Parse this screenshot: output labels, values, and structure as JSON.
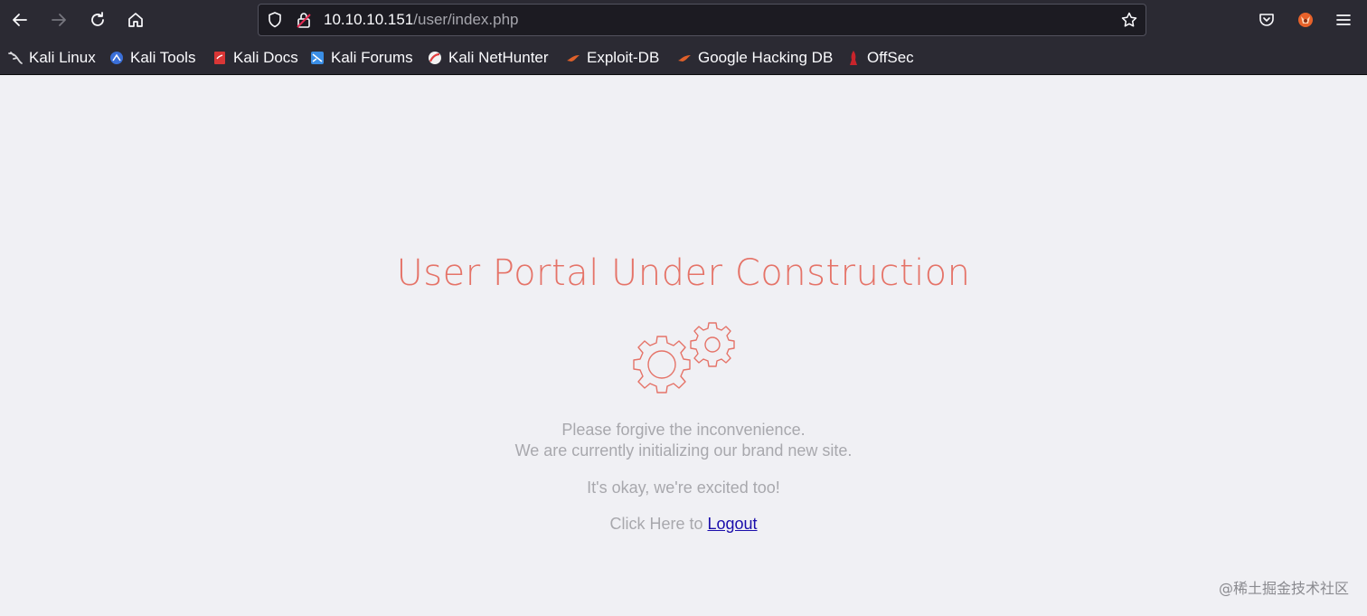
{
  "browser": {
    "url": {
      "host": "10.10.10.151",
      "path": "/user/index.php"
    },
    "bookmarks": [
      {
        "label": "Kali Linux",
        "icon": "kali-dragon-icon",
        "color": "#1c1c1c"
      },
      {
        "label": "Kali Tools",
        "icon": "kali-tools-icon",
        "color": "#3a6fd8"
      },
      {
        "label": "Kali Docs",
        "icon": "kali-docs-icon",
        "color": "#d93636"
      },
      {
        "label": "Kali Forums",
        "icon": "kali-forums-icon",
        "color": "#3a8ee6"
      },
      {
        "label": "Kali NetHunter",
        "icon": "nethunter-icon",
        "color": "#e23d3d"
      },
      {
        "label": "Exploit-DB",
        "icon": "exploit-db-icon",
        "color": "#e0602a"
      },
      {
        "label": "Google Hacking DB",
        "icon": "ghdb-icon",
        "color": "#e0602a"
      },
      {
        "label": "OffSec",
        "icon": "offsec-icon",
        "color": "#c9242b"
      }
    ]
  },
  "page": {
    "title": "User Portal Under Construction",
    "line1": "Please forgive the inconvenience.",
    "line2": "We are currently initializing our brand new site.",
    "line3": "It's okay, we're excited too!",
    "click_prefix": "Click Here to ",
    "logout_label": "Logout",
    "accent_color": "#e57368"
  },
  "watermark": "@稀土掘金技术社区"
}
